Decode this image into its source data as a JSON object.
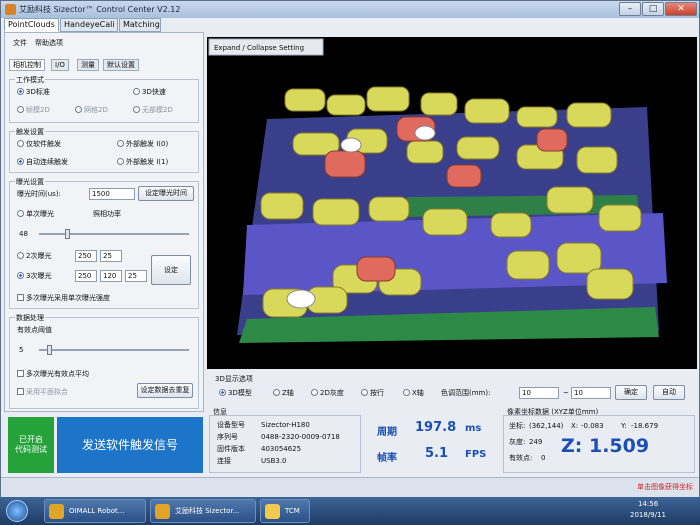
{
  "window": {
    "title": "艾励科技 Sizector™ Control Center V2.12"
  },
  "main_tabs": [
    "PointClouds",
    "HandeyeCali",
    "Matching"
  ],
  "menu": [
    "文件",
    "帮助选项"
  ],
  "sub_tabs": [
    "相机控制",
    "I/O",
    "测量",
    "默认设置"
  ],
  "work_mode": {
    "title": "工作模式",
    "options": [
      "3D标准",
      "3D快速",
      "帧模2D",
      "网格2D",
      "无部模2D"
    ]
  },
  "trigger": {
    "title": "触发设置",
    "options": [
      "仅软件触发",
      "外部触发 I(0)",
      "自动连续触发",
      "外部触发 I(1)"
    ]
  },
  "exposure": {
    "title": "曝光设置",
    "time_label": "曝光时间(us):",
    "time_value": "1500",
    "set_time_button": "设定曝光时间",
    "single_label": "单次曝光",
    "gain_label": "照相功率",
    "single_value": "48",
    "double_label": "2次曝光",
    "double_values": [
      "250",
      "25"
    ],
    "triple_label": "3次曝光",
    "triple_values": [
      "250",
      "120",
      "25"
    ],
    "set_button": "设定",
    "multi_label": "多次曝光采用单次曝光强度"
  },
  "filter": {
    "title": "数据处理",
    "valid_label": "有效点阈值",
    "valid_value": "5",
    "multi_avg_label": "多次曝光有效点平均",
    "plane_label": "采用平面拟合",
    "button": "设定数据去重复"
  },
  "actions": {
    "green_label_1": "已开启",
    "green_label_2": "代码测试",
    "blue_label": "发送软件触发信号"
  },
  "viewer": {
    "expand_button": "Expand / Collapse Setting"
  },
  "display_mode": {
    "title": "3D显示选项",
    "options": [
      "3D模型",
      "Z轴",
      "2D灰度",
      "按行",
      "X轴"
    ],
    "range_label": "色调范围(mm):",
    "range_min": "10",
    "range_max": "10",
    "apply_button": "确定",
    "auto_button": "自动"
  },
  "device_info": {
    "title": "信息",
    "rows": [
      [
        "设备型号",
        "Sizector-H180"
      ],
      [
        "序列号",
        "0488-2320-0009-0718"
      ],
      [
        "固件版本",
        "403054625"
      ],
      [
        "连接",
        "USB3.0"
      ]
    ]
  },
  "timing": {
    "period_label": "周期",
    "period_value": "197.8",
    "period_unit": "ms",
    "rate_label": "帧率",
    "rate_value": "5.1",
    "rate_unit": "FPS"
  },
  "coords": {
    "title": "像素坐标数据 (XYZ单位mm)",
    "pos_label": "坐标:",
    "pos_value": "(362,144)",
    "x_label": "X:",
    "x_value": "-0.083",
    "y_label": "Y:",
    "y_value": "-18.679",
    "gray_label": "灰度:",
    "gray_value": "249",
    "flag_label": "有效点:",
    "flag_value": "0",
    "z_display": "Z: 1.509"
  },
  "status": {
    "right_text": "单击图像获得坐标"
  },
  "taskbar": {
    "items": [
      "OIMALL Robot...",
      "艾励科技 Sizector...",
      "TCM"
    ],
    "time": "14:56",
    "date": "2018/9/11"
  },
  "colors": {
    "blue": "#1c75c9",
    "green": "#26a23b",
    "zblue": "#1c4fb3",
    "red": "#d12424"
  }
}
